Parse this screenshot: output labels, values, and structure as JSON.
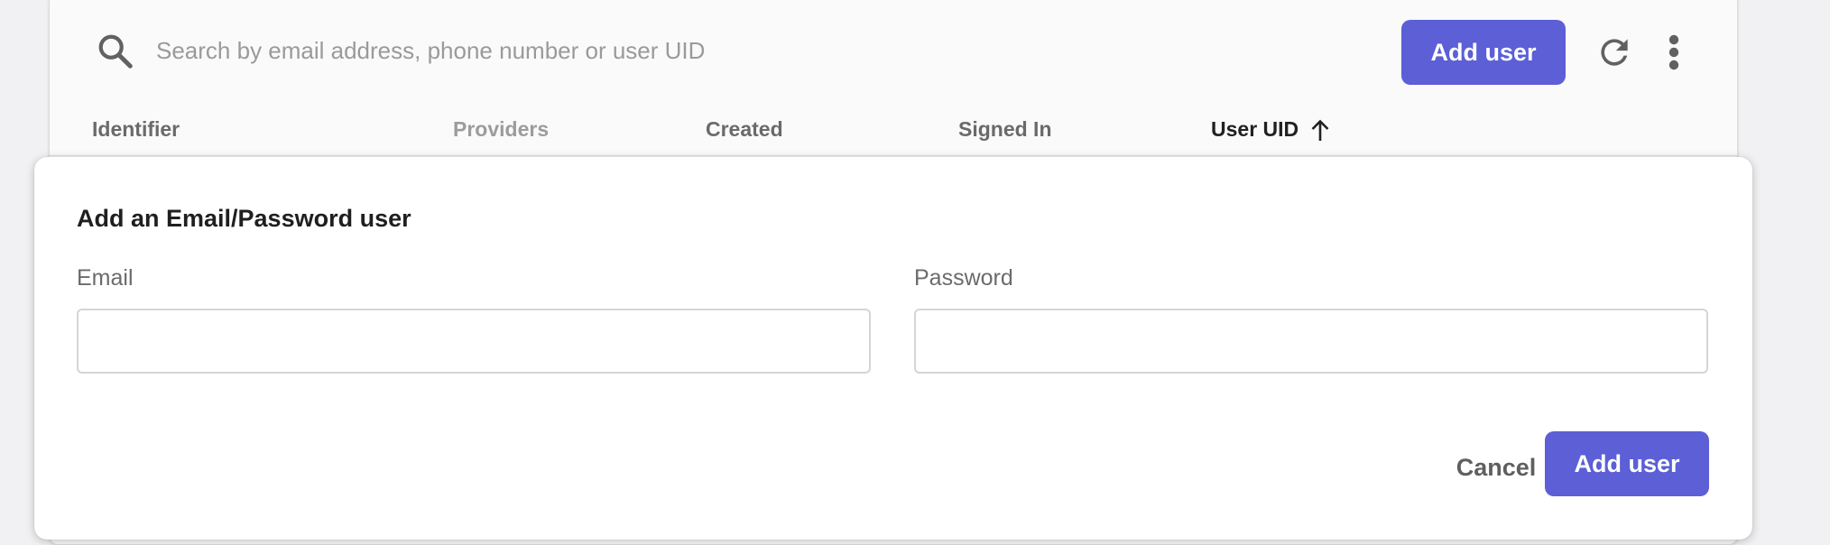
{
  "toolbar": {
    "search_placeholder": "Search by email address, phone number or user UID",
    "add_user_label": "Add user",
    "icons": [
      "search-icon",
      "refresh-icon",
      "more-vert-icon"
    ]
  },
  "table": {
    "columns": [
      "Identifier",
      "Providers",
      "Created",
      "Signed In",
      "User UID"
    ],
    "sorted_column": "User UID",
    "sort_direction": "ascending"
  },
  "dialog": {
    "title": "Add an Email/Password user",
    "email_label": "Email",
    "email_value": "",
    "password_label": "Password",
    "password_value": "",
    "cancel_label": "Cancel",
    "submit_label": "Add user"
  },
  "colors": {
    "accent": "#5c5fd6",
    "card_background": "#fafafa",
    "page_background": "#f1f1f3"
  }
}
